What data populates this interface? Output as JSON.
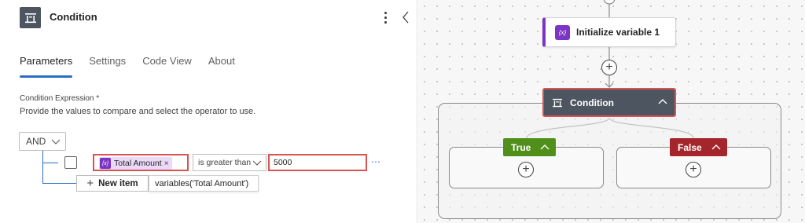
{
  "panel": {
    "title": "Condition",
    "title_icon": "condition-icon",
    "menu_icon": "more-vertical-icon",
    "collapse_icon": "chevron-left-icon",
    "tabs": [
      {
        "label": "Parameters",
        "active": true
      },
      {
        "label": "Settings",
        "active": false
      },
      {
        "label": "Code View",
        "active": false
      },
      {
        "label": "About",
        "active": false
      }
    ],
    "expression_label": "Condition Expression *",
    "expression_description": "Provide the values to compare and select the operator to use.",
    "group_operator": "AND",
    "row": {
      "checked": false,
      "operand_token": "Total Amount",
      "operand_token_remove": "×",
      "operator": "is greater than",
      "value": "5000",
      "more": "⋯"
    },
    "new_item_label": "New item",
    "new_item_icon": "+",
    "tooltip": "variables('Total Amount')"
  },
  "canvas": {
    "init_node": {
      "title": "Initialize variable 1",
      "icon": "variable-icon",
      "icon_text": "{x}"
    },
    "add_step": "+",
    "condition_node": {
      "title": "Condition",
      "icon": "condition-icon",
      "collapse_icon": "chevron-up-icon"
    },
    "branches": [
      {
        "label": "True",
        "color": "#4f8f1a",
        "add": "+",
        "collapse_icon": "chevron-up-icon"
      },
      {
        "label": "False",
        "color": "#a4262c",
        "add": "+",
        "collapse_icon": "chevron-up-icon"
      }
    ]
  },
  "colors": {
    "accent": "#2b6cc4",
    "variable_purple": "#7a35c4",
    "highlight_red": "#d9534f",
    "condition_dark": "#4d5560"
  },
  "token_icon_text": "{x}"
}
